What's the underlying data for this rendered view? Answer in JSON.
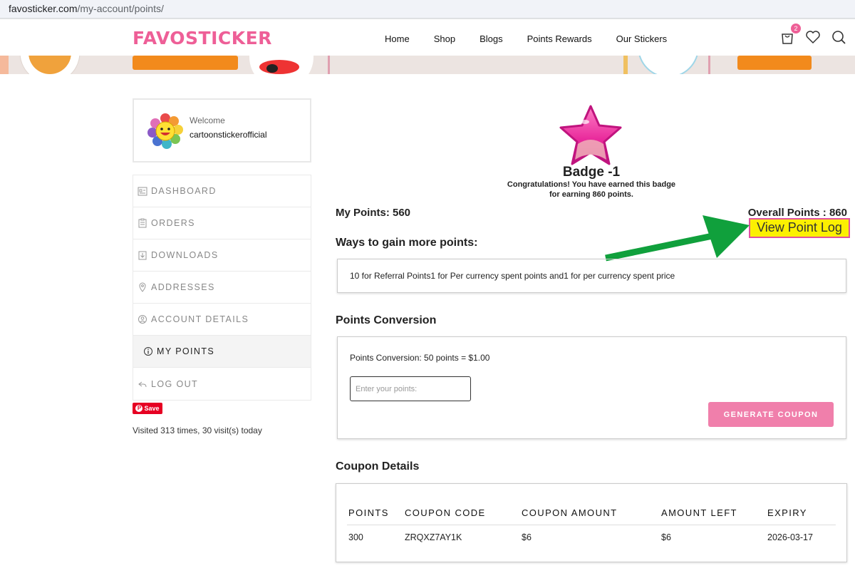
{
  "browser": {
    "url_host": "favosticker.com",
    "url_path": "/my-account/points/"
  },
  "header": {
    "logo": "FAVOSTICKER",
    "nav": [
      "Home",
      "Shop",
      "Blogs",
      "Points Rewards",
      "Our Stickers"
    ],
    "cart_count": "2",
    "icons": [
      "cart-icon",
      "heart-icon",
      "search-icon"
    ]
  },
  "sidebar": {
    "welcome_label": "Welcome",
    "username": "cartoonstickerofficial",
    "menu": [
      {
        "label": "DASHBOARD",
        "icon": "dashboard-icon"
      },
      {
        "label": "ORDERS",
        "icon": "clipboard-icon"
      },
      {
        "label": "DOWNLOADS",
        "icon": "download-icon"
      },
      {
        "label": "ADDRESSES",
        "icon": "location-pin-icon"
      },
      {
        "label": "ACCOUNT DETAILS",
        "icon": "user-icon"
      },
      {
        "label": "MY POINTS",
        "icon": "info-icon"
      },
      {
        "label": "LOG OUT",
        "icon": "logout-icon"
      }
    ],
    "save_button": "Save",
    "visited_text": "Visited 313 times, 30 visit(s) today"
  },
  "badge": {
    "title": "Badge -1",
    "text": "Congratulations! You have earned this badge for earning 860 points."
  },
  "points": {
    "my_points": "My Points: 560",
    "overall_points": "Overall Points : 860",
    "view_log": "View Point Log"
  },
  "ways": {
    "heading": "Ways to gain more points:",
    "text": "10 for Referral Points1 for Per currency spent points and1 for per currency spent price"
  },
  "conversion": {
    "heading": "Points Conversion",
    "text": "Points Conversion: 50 points = $1.00",
    "input_placeholder": "Enter your points:",
    "button": "GENERATE COUPON"
  },
  "coupons": {
    "heading": "Coupon Details",
    "columns": [
      "POINTS",
      "COUPON CODE",
      "COUPON AMOUNT",
      "AMOUNT LEFT",
      "EXPIRY"
    ],
    "rows": [
      [
        "300",
        "ZRQXZ7AY1K",
        "$6",
        "$6",
        "2026-03-17"
      ]
    ]
  },
  "colors": {
    "brand_pink": "#ee5f97",
    "button_pink": "#f07fab",
    "highlight_yellow": "#fcf000",
    "arrow_green": "#10a03c"
  }
}
